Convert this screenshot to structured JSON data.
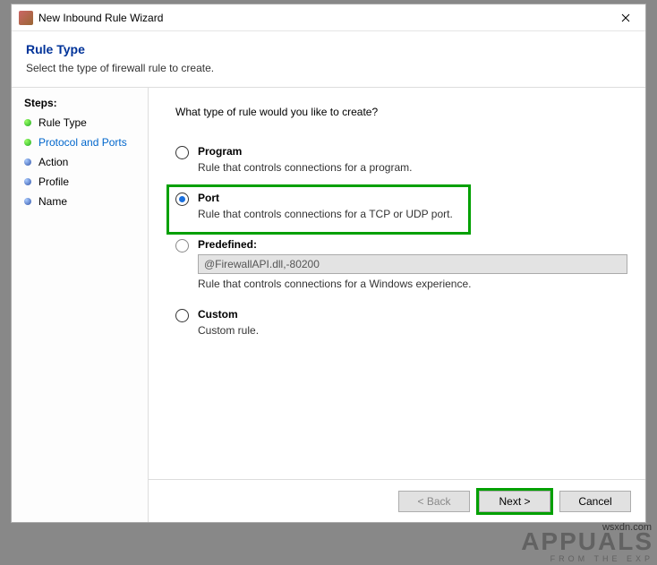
{
  "window": {
    "title": "New Inbound Rule Wizard"
  },
  "header": {
    "title": "Rule Type",
    "subtitle": "Select the type of firewall rule to create."
  },
  "sidebar": {
    "heading": "Steps:",
    "steps": [
      {
        "label": "Rule Type",
        "bullet": "green",
        "selected": false
      },
      {
        "label": "Protocol and Ports",
        "bullet": "green",
        "selected": true
      },
      {
        "label": "Action",
        "bullet": "blue",
        "selected": false
      },
      {
        "label": "Profile",
        "bullet": "blue",
        "selected": false
      },
      {
        "label": "Name",
        "bullet": "blue",
        "selected": false
      }
    ]
  },
  "content": {
    "prompt": "What type of rule would you like to create?",
    "options": [
      {
        "id": "program",
        "title": "Program",
        "desc": "Rule that controls connections for a program.",
        "checked": false,
        "disabled": false,
        "highlighted": false
      },
      {
        "id": "port",
        "title": "Port",
        "desc": "Rule that controls connections for a TCP or UDP port.",
        "checked": true,
        "disabled": false,
        "highlighted": true
      },
      {
        "id": "predefined",
        "title": "Predefined:",
        "desc": "Rule that controls connections for a Windows experience.",
        "checked": false,
        "disabled": true,
        "highlighted": false,
        "dropdown": "@FirewallAPI.dll,-80200"
      },
      {
        "id": "custom",
        "title": "Custom",
        "desc": "Custom rule.",
        "checked": false,
        "disabled": false,
        "highlighted": false
      }
    ]
  },
  "footer": {
    "back": "< Back",
    "next": "Next >",
    "cancel": "Cancel"
  },
  "watermark": {
    "big": "APPUALS",
    "small": "FROM   THE   EXP",
    "url": "wsxdn.com"
  }
}
